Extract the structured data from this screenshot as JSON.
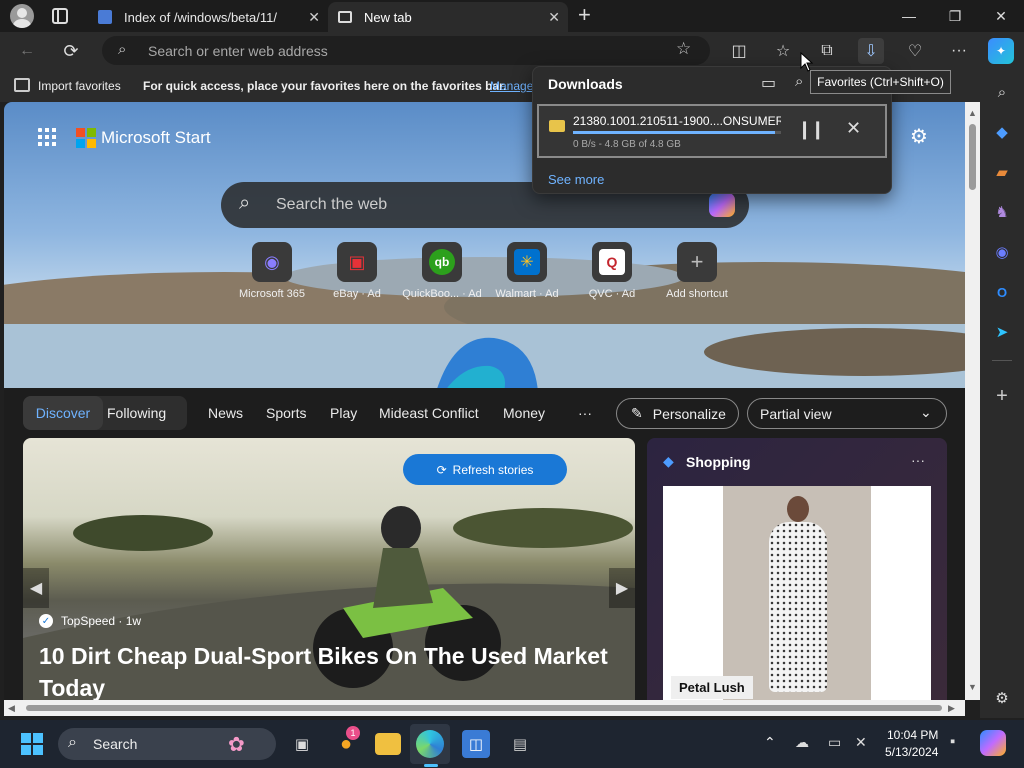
{
  "tabs": [
    {
      "label": "Index of /windows/beta/11/",
      "active": false
    },
    {
      "label": "New tab",
      "active": true
    }
  ],
  "address_bar": {
    "placeholder": "Search or enter web address"
  },
  "favorites_bar": {
    "import_label": "Import favorites",
    "hint_text": "For quick access, place your favorites here on the favorites bar.",
    "manage_link": "Manage"
  },
  "tooltip": "Favorites (Ctrl+Shift+O)",
  "downloads": {
    "title": "Downloads",
    "item": {
      "filename": "21380.1001.210511-1900....ONSUMER_(",
      "status": "0 B/s - 4.8 GB of 4.8 GB",
      "progress": 0.97
    },
    "see_more": "See more"
  },
  "start": {
    "brand": "Microsoft Start",
    "search_placeholder": "Search the web",
    "shortcuts": [
      {
        "label": "Microsoft 365",
        "ad": "",
        "icon": "microsoft-365-icon"
      },
      {
        "label": "eBay",
        "ad": "· Ad",
        "icon": "ebay-icon"
      },
      {
        "label": "QuickBoo...",
        "ad": "· Ad",
        "icon": "quickbooks-icon"
      },
      {
        "label": "Walmart",
        "ad": "· Ad",
        "icon": "walmart-icon"
      },
      {
        "label": "QVC",
        "ad": "· Ad",
        "icon": "qvc-icon"
      },
      {
        "label": "Add shortcut",
        "ad": "",
        "icon": "plus-icon"
      }
    ]
  },
  "feed": {
    "nav": {
      "discover": "Discover",
      "following": "Following",
      "links": [
        "News",
        "Sports",
        "Play",
        "Mideast Conflict",
        "Money"
      ],
      "more": "···",
      "personalize": "Personalize",
      "view": "Partial view"
    },
    "hero": {
      "refresh": "Refresh stories",
      "source": "TopSpeed · 1w",
      "headline": "10 Dirt Cheap Dual-Sport Bikes On The Used Market Today"
    },
    "shopping": {
      "title": "Shopping",
      "more": "···",
      "product_label": "Petal Lush"
    }
  },
  "taskbar": {
    "search": "Search",
    "time": "10:04 PM",
    "date": "5/13/2024",
    "badge": "1"
  }
}
